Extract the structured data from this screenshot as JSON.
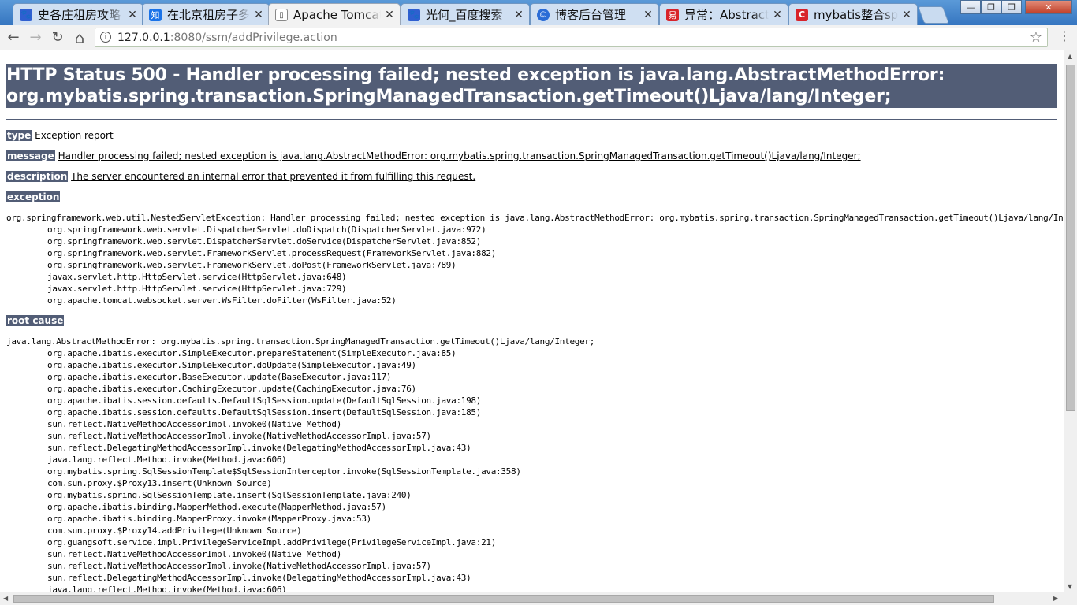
{
  "tabs": [
    {
      "title": "史各庄租房攻略",
      "favicon": "paw",
      "color": "#2f5fd0",
      "glyph": "🐾"
    },
    {
      "title": "在北京租房子多",
      "favicon": "zhi",
      "color": "#1a73e8",
      "glyph": "知"
    },
    {
      "title": "Apache Tomcat",
      "favicon": "page",
      "color": "#ffffff",
      "glyph": "🗋"
    },
    {
      "title": "光何_百度搜索",
      "favicon": "paw",
      "color": "#2f5fd0",
      "glyph": "🐾"
    },
    {
      "title": "博客后台管理",
      "favicon": "blog",
      "color": "#2b6cd6",
      "glyph": "©"
    },
    {
      "title": "异常：AbstractM",
      "favicon": "csdn-red",
      "color": "#d8232a",
      "glyph": "易"
    },
    {
      "title": "mybatis整合sp",
      "favicon": "csdn",
      "color": "#d8232a",
      "glyph": "C"
    }
  ],
  "window_controls": {
    "minimize": "—",
    "restore": "❐",
    "close": "✕"
  },
  "toolbar": {
    "back": "←",
    "forward": "→",
    "reload": "↻",
    "home": "⌂",
    "url_host": "127.0.0.1",
    "url_path": ":8080/ssm/addPrivilege.action",
    "info_icon": "i",
    "star": "☆",
    "menu": "⋮"
  },
  "error_page": {
    "title_line1": "HTTP Status 500 - Handler processing failed; nested exception is java.lang.AbstractMethodError:",
    "title_line2": "org.mybatis.spring.transaction.SpringManagedTransaction.getTimeout()Ljava/lang/Integer;",
    "type_label": "type",
    "type_value": "Exception report",
    "message_label": "message",
    "message_value": "Handler processing failed; nested exception is java.lang.AbstractMethodError: org.mybatis.spring.transaction.SpringManagedTransaction.getTimeout()Ljava/lang/Integer;",
    "description_label": "description",
    "description_value": "The server encountered an internal error that prevented it from fulfilling this request.",
    "exception_label": "exception",
    "exception_trace": [
      "org.springframework.web.util.NestedServletException: Handler processing failed; nested exception is java.lang.AbstractMethodError: org.mybatis.spring.transaction.SpringManagedTransaction.getTimeout()Ljava/lang/Integer;",
      "\torg.springframework.web.servlet.DispatcherServlet.doDispatch(DispatcherServlet.java:972)",
      "\torg.springframework.web.servlet.DispatcherServlet.doService(DispatcherServlet.java:852)",
      "\torg.springframework.web.servlet.FrameworkServlet.processRequest(FrameworkServlet.java:882)",
      "\torg.springframework.web.servlet.FrameworkServlet.doPost(FrameworkServlet.java:789)",
      "\tjavax.servlet.http.HttpServlet.service(HttpServlet.java:648)",
      "\tjavax.servlet.http.HttpServlet.service(HttpServlet.java:729)",
      "\torg.apache.tomcat.websocket.server.WsFilter.doFilter(WsFilter.java:52)"
    ],
    "root_cause_label": "root cause",
    "root_cause_trace": [
      "java.lang.AbstractMethodError: org.mybatis.spring.transaction.SpringManagedTransaction.getTimeout()Ljava/lang/Integer;",
      "\torg.apache.ibatis.executor.SimpleExecutor.prepareStatement(SimpleExecutor.java:85)",
      "\torg.apache.ibatis.executor.SimpleExecutor.doUpdate(SimpleExecutor.java:49)",
      "\torg.apache.ibatis.executor.BaseExecutor.update(BaseExecutor.java:117)",
      "\torg.apache.ibatis.executor.CachingExecutor.update(CachingExecutor.java:76)",
      "\torg.apache.ibatis.session.defaults.DefaultSqlSession.update(DefaultSqlSession.java:198)",
      "\torg.apache.ibatis.session.defaults.DefaultSqlSession.insert(DefaultSqlSession.java:185)",
      "\tsun.reflect.NativeMethodAccessorImpl.invoke0(Native Method)",
      "\tsun.reflect.NativeMethodAccessorImpl.invoke(NativeMethodAccessorImpl.java:57)",
      "\tsun.reflect.DelegatingMethodAccessorImpl.invoke(DelegatingMethodAccessorImpl.java:43)",
      "\tjava.lang.reflect.Method.invoke(Method.java:606)",
      "\torg.mybatis.spring.SqlSessionTemplate$SqlSessionInterceptor.invoke(SqlSessionTemplate.java:358)",
      "\tcom.sun.proxy.$Proxy13.insert(Unknown Source)",
      "\torg.mybatis.spring.SqlSessionTemplate.insert(SqlSessionTemplate.java:240)",
      "\torg.apache.ibatis.binding.MapperMethod.execute(MapperMethod.java:57)",
      "\torg.apache.ibatis.binding.MapperProxy.invoke(MapperProxy.java:53)",
      "\tcom.sun.proxy.$Proxy14.addPrivilege(Unknown Source)",
      "\torg.guangsoft.service.impl.PrivilegeServiceImpl.addPrivilege(PrivilegeServiceImpl.java:21)",
      "\tsun.reflect.NativeMethodAccessorImpl.invoke0(Native Method)",
      "\tsun.reflect.NativeMethodAccessorImpl.invoke(NativeMethodAccessorImpl.java:57)",
      "\tsun.reflect.DelegatingMethodAccessorImpl.invoke(DelegatingMethodAccessorImpl.java:43)",
      "\tjava.lang.reflect.Method.invoke(Method.java:606)"
    ]
  },
  "colors": {
    "tomcat_header": "#525d76",
    "tabstrip": "#3b7fc4",
    "omnibox_border": "#b9c9b2"
  }
}
